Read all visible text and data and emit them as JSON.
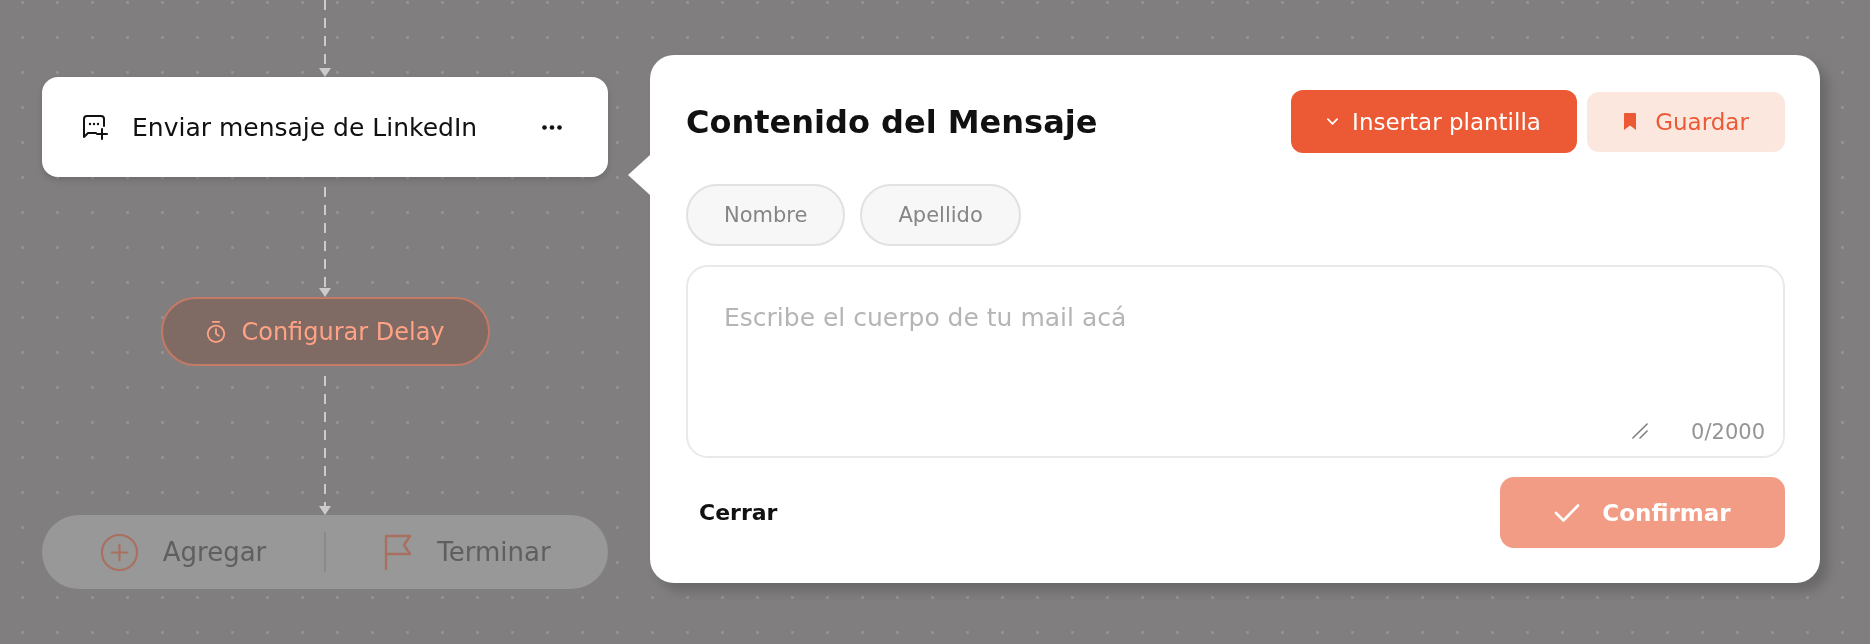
{
  "canvas": {
    "nodes": [
      {
        "kind": "action",
        "label": "Enviar mensaje de LinkedIn",
        "dimmed": false
      },
      {
        "kind": "delay",
        "label": "Configurar Delay",
        "dimmed": true
      },
      {
        "kind": "actions_bar",
        "dimmed": true,
        "items": [
          {
            "kind": "add",
            "label": "Agregar"
          },
          {
            "kind": "finish",
            "label": "Terminar"
          }
        ]
      }
    ]
  },
  "panel": {
    "title": "Contenido del Mensaje",
    "actions": [
      {
        "kind": "template",
        "label": "Insertar plantilla"
      },
      {
        "kind": "save",
        "label": "Guardar"
      }
    ],
    "variables": [
      "Nombre",
      "Apellido"
    ],
    "message": {
      "placeholder": "Escribe el cuerpo de tu mail acá",
      "counter": "0/2000"
    },
    "footer": {
      "close": "Cerrar",
      "confirm": {
        "label": "Confirmar",
        "disabled": true
      }
    }
  }
}
